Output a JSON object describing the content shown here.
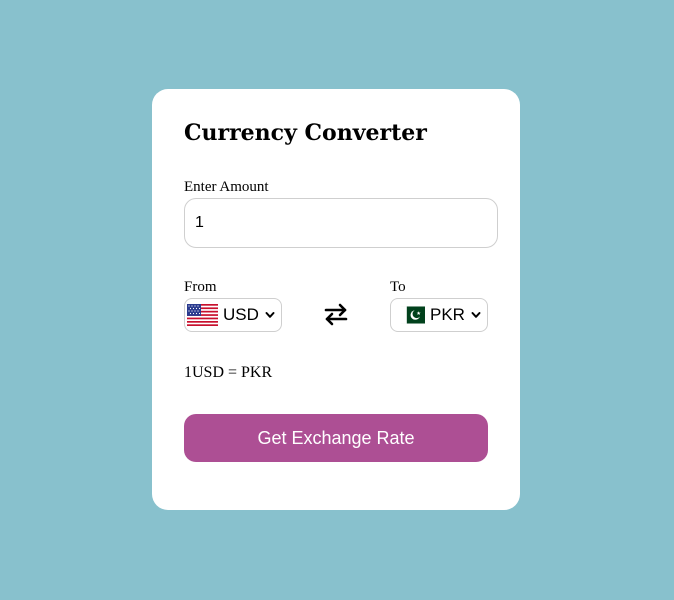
{
  "converter": {
    "title": "Currency Converter",
    "amount_label": "Enter Amount",
    "amount_value": "1",
    "from_label": "From",
    "from_currency": "USD",
    "from_flag_icon": "us-flag-icon",
    "to_label": "To",
    "to_currency": "PKR",
    "to_flag_icon": "pk-flag-icon",
    "swap_icon": "swap-arrows-icon",
    "rate_text": "1USD = PKR",
    "button_label": "Get Exchange Rate"
  },
  "colors": {
    "background": "#88c1cd",
    "card": "#ffffff",
    "button": "#ad4f94"
  }
}
